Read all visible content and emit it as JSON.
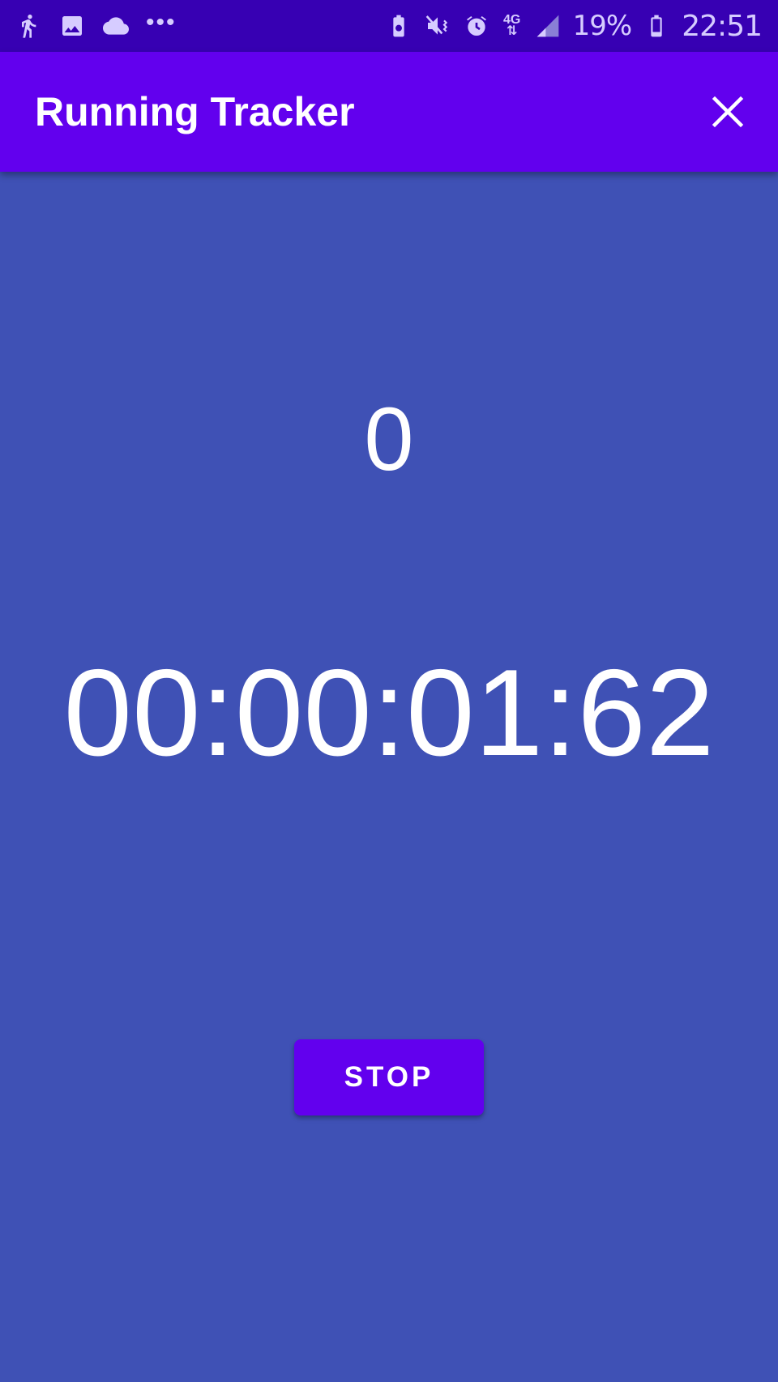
{
  "status_bar": {
    "left_icons": [
      "running-person-icon",
      "image-icon",
      "cloud-icon"
    ],
    "more_indicator": "•••",
    "right_icons": [
      "battery-saver-icon",
      "mute-vibrate-icon",
      "alarm-icon"
    ],
    "network_type": "4G",
    "battery_percent": "19%",
    "time": "22:51"
  },
  "app_bar": {
    "title": "Running Tracker",
    "close_icon": "close-icon"
  },
  "tracker": {
    "distance": "0",
    "elapsed_time": "00:00:01:62",
    "stop_label": "STOP"
  },
  "colors": {
    "status_bar": "#3700b3",
    "app_bar": "#6200ee",
    "background": "#3f51b5",
    "button": "#6200ee",
    "text": "#ffffff"
  }
}
